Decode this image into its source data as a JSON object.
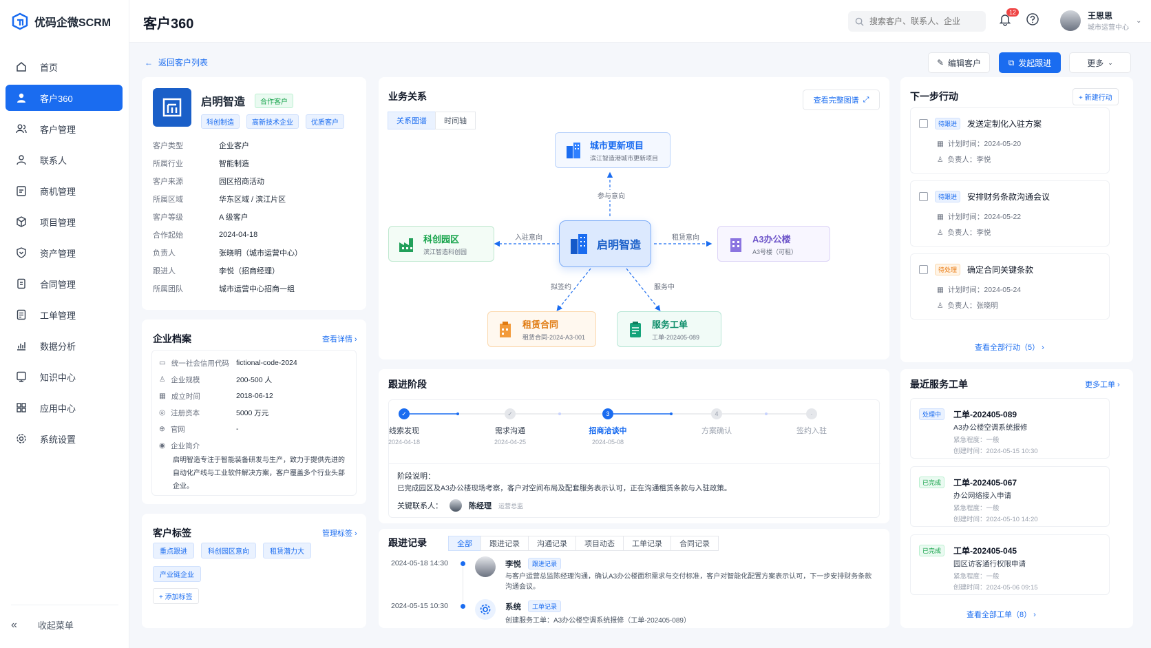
{
  "app": {
    "name": "优码企微SCRM"
  },
  "sidebar": {
    "items": [
      {
        "label": "首页",
        "icon": "home-icon"
      },
      {
        "label": "客户360",
        "icon": "user-icon"
      },
      {
        "label": "客户管理",
        "icon": "users-icon"
      },
      {
        "label": "联系人",
        "icon": "contact-icon"
      },
      {
        "label": "商机管理",
        "icon": "clipboard-icon"
      },
      {
        "label": "项目管理",
        "icon": "box-icon"
      },
      {
        "label": "资产管理",
        "icon": "shield-icon"
      },
      {
        "label": "合同管理",
        "icon": "document-icon"
      },
      {
        "label": "工单管理",
        "icon": "ticket-icon"
      },
      {
        "label": "数据分析",
        "icon": "chart-icon"
      },
      {
        "label": "知识中心",
        "icon": "book-icon"
      },
      {
        "label": "应用中心",
        "icon": "grid-icon"
      },
      {
        "label": "系统设置",
        "icon": "gear-icon"
      }
    ],
    "collapse_label": "收起菜单"
  },
  "header": {
    "title": "客户360",
    "search_placeholder": "搜索客户、联系人、企业",
    "notification_count": "12",
    "user_name": "王思思",
    "user_role": "城市运营中心"
  },
  "toolbar": {
    "back_label": "返回客户列表",
    "edit_label": "编辑客户",
    "follow_label": "发起跟进",
    "more_label": "更多"
  },
  "customer": {
    "name": "启明智造",
    "status_tag": "合作客户",
    "tags": [
      "科创制造",
      "高新技术企业",
      "优质客户"
    ],
    "fields": [
      {
        "k": "客户类型",
        "v": "企业客户"
      },
      {
        "k": "所属行业",
        "v": "智能制造"
      },
      {
        "k": "客户来源",
        "v": "园区招商活动"
      },
      {
        "k": "所属区域",
        "v": "华东区域 / 滨江片区"
      },
      {
        "k": "客户等级",
        "v": "A 级客户"
      },
      {
        "k": "合作起始",
        "v": "2024-04-18"
      },
      {
        "k": "负责人",
        "v": "张晓明（城市运营中心）"
      },
      {
        "k": "跟进人",
        "v": "李悦（招商经理）"
      },
      {
        "k": "所属团队",
        "v": "城市运营中心招商一组"
      }
    ]
  },
  "profile": {
    "title": "企业档案",
    "link": "查看详情",
    "rows": [
      {
        "k": "统一社会信用代码",
        "v": "fictional-code-2024",
        "icon": "id-card-icon"
      },
      {
        "k": "企业规模",
        "v": "200-500 人",
        "icon": "people-icon"
      },
      {
        "k": "成立时间",
        "v": "2018-06-12",
        "icon": "calendar-icon"
      },
      {
        "k": "注册资本",
        "v": "5000 万元",
        "icon": "money-icon"
      },
      {
        "k": "官网",
        "v": "-",
        "icon": "globe-icon"
      }
    ],
    "intro_label": "企业简介",
    "intro": "启明智造专注于智能装备研发与生产，致力于提供先进的自动化产线与工业软件解决方案，客户覆盖多个行业头部企业。"
  },
  "customer_tags": {
    "title": "客户标签",
    "link": "管理标签",
    "tags": [
      "重点跟进",
      "科创园区意向",
      "租赁潜力大",
      "产业链企业"
    ],
    "add_label": "+ 添加标签"
  },
  "relation": {
    "title": "业务关系",
    "link": "查看完整图谱",
    "tabs": [
      "关系图谱",
      "时间轴"
    ],
    "center": {
      "title": "启明智造"
    },
    "nodes": [
      {
        "title": "城市更新项目",
        "sub": "滨江智造港城市更新项目"
      },
      {
        "title": "科创园区",
        "sub": "滨江智造科创园"
      },
      {
        "title": "A3办公楼",
        "sub": "A3号楼（可租）"
      },
      {
        "title": "租赁合同",
        "sub": "租赁合同-2024-A3-001"
      },
      {
        "title": "服务工单",
        "sub": "工单-202405-089"
      }
    ],
    "edges": [
      "参与意向",
      "入驻意向",
      "租赁意向",
      "拟签约",
      "服务中"
    ]
  },
  "stages": {
    "title": "跟进阶段",
    "steps": [
      {
        "name": "线索发现",
        "date": "2024-04-18"
      },
      {
        "name": "需求沟通",
        "date": "2024-04-25"
      },
      {
        "name": "招商洽谈中",
        "date": "2024-05-08"
      },
      {
        "name": "方案确认",
        "date": ""
      },
      {
        "name": "签约入驻",
        "date": ""
      }
    ],
    "current_step_number": "3",
    "pending_step_number": "4",
    "desc_label": "阶段说明：",
    "desc": "已完成园区及A3办公楼现场考察，客户对空间布局及配套服务表示认可，正在沟通租赁条款与入驻政策。",
    "contact_label": "关键联系人：",
    "contact_name": "陈经理",
    "contact_role": "运营总监"
  },
  "records": {
    "title": "跟进记录",
    "tabs": [
      "全部",
      "跟进记录",
      "沟通记录",
      "项目动态",
      "工单记录",
      "合同记录"
    ],
    "items": [
      {
        "time": "2024-05-18  14:30",
        "who": "李悦",
        "tag": "跟进记录",
        "text": "与客户运营总监陈经理沟通，确认A3办公楼面积需求与交付标准，客户对智能化配置方案表示认可，下一步安排财务条款沟通会议。"
      },
      {
        "time": "2024-05-15  10:30",
        "who": "系统",
        "tag": "工单记录",
        "text": "创建服务工单：A3办公楼空调系统报修（工单-202405-089）"
      }
    ]
  },
  "next_actions": {
    "title": "下一步行动",
    "new_label": "+ 新建行动",
    "items": [
      {
        "status": "待跟进",
        "title": "发送定制化入驻方案",
        "plan": "计划时间：2024-05-20",
        "owner": "负责人：李悦"
      },
      {
        "status": "待跟进",
        "title": "安排财务条款沟通会议",
        "plan": "计划时间：2024-05-22",
        "owner": "负责人：李悦"
      },
      {
        "status": "待处理",
        "title": "确定合同关键条款",
        "plan": "计划时间：2024-05-24",
        "owner": "负责人：张晓明"
      }
    ],
    "view_all": "查看全部行动（5）"
  },
  "tickets": {
    "title": "最近服务工单",
    "link": "更多工单",
    "items": [
      {
        "status": "处理中",
        "id": "工单-202405-089",
        "desc": "A3办公楼空调系统报修",
        "urgency": "紧急程度：一般",
        "created": "创建时间：2024-05-15 10:30"
      },
      {
        "status": "已完成",
        "id": "工单-202405-067",
        "desc": "办公网络接入申请",
        "urgency": "紧急程度：一般",
        "created": "创建时间：2024-05-10 14:20"
      },
      {
        "status": "已完成",
        "id": "工单-202405-045",
        "desc": "园区访客通行权限申请",
        "urgency": "紧急程度：一般",
        "created": "创建时间：2024-05-06 09:15"
      }
    ],
    "view_all": "查看全部工单（8）"
  },
  "colors": {
    "accent": "#1a6cf0",
    "success": "#16a34a",
    "warning": "#ea7a10",
    "danger": "#ef4444"
  }
}
